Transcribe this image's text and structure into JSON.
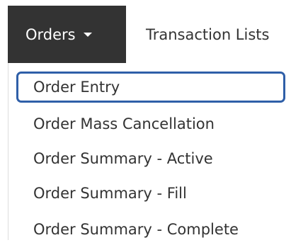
{
  "nav": {
    "orders_label": "Orders",
    "transactions_label": "Transaction Lists"
  },
  "dropdown": {
    "items": [
      {
        "label": "Order Entry",
        "focused": true
      },
      {
        "label": "Order Mass Cancellation"
      },
      {
        "label": "Order Summary - Active"
      },
      {
        "label": "Order Summary - Fill"
      },
      {
        "label": "Order Summary - Complete"
      }
    ]
  },
  "colors": {
    "nav_active_bg": "#333333",
    "focus_border": "#2f5fa8",
    "text": "#333333"
  }
}
